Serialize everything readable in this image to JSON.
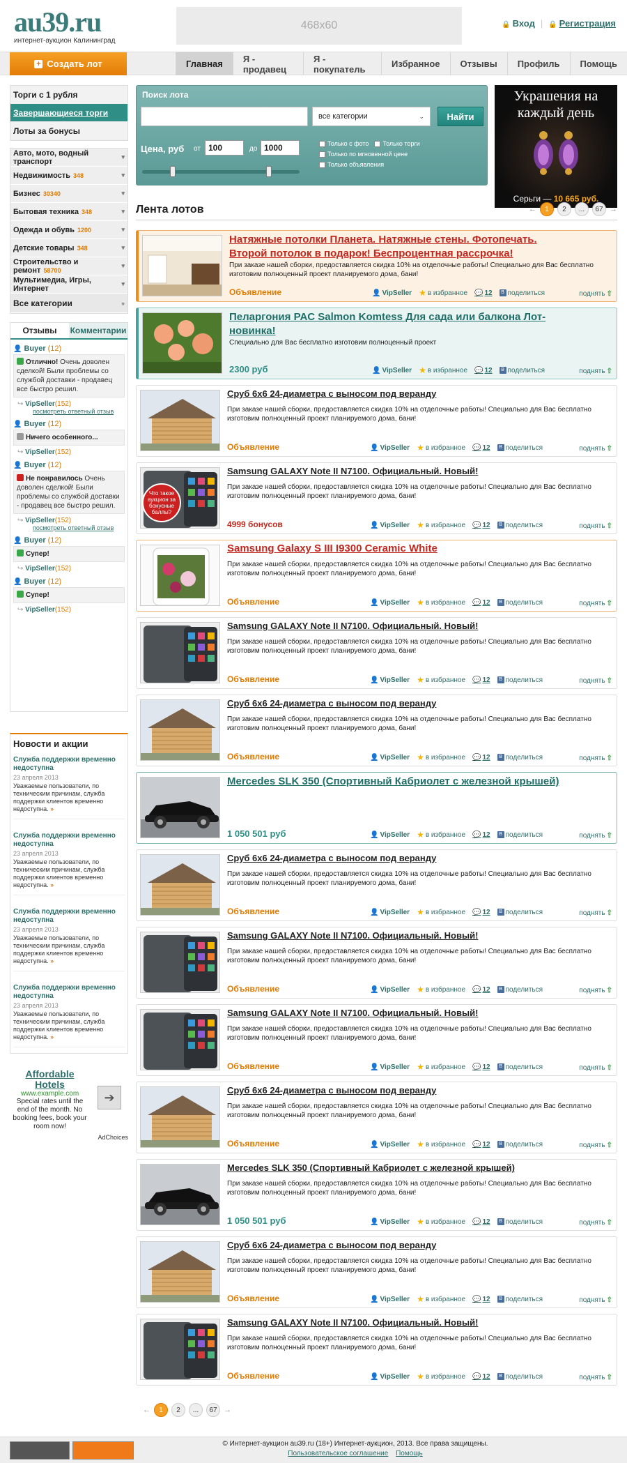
{
  "header": {
    "logo": "au39.ru",
    "logo_sub": "интернет-аукцион Калининград",
    "banner": "468x60",
    "login": "Вход",
    "register": "Регистрация"
  },
  "nav": {
    "create": "Создать лот",
    "tabs": [
      "Главная",
      "Я - продавец",
      "Я - покупатель",
      "Избранное",
      "Отзывы",
      "Профиль",
      "Помощь"
    ]
  },
  "left": {
    "links": [
      "Торги с 1 рубля",
      "Завершающиеся торги",
      "Лоты за бонусы"
    ],
    "categories": [
      {
        "name": "Авто, мото, водный транспорт",
        "count": ""
      },
      {
        "name": "Недвижимость",
        "count": "348"
      },
      {
        "name": "Бизнес",
        "count": "30340"
      },
      {
        "name": "Бытовая техника",
        "count": "348"
      },
      {
        "name": "Одежда и обувь",
        "count": "1200"
      },
      {
        "name": "Детские товары",
        "count": "348"
      },
      {
        "name": "Строительство и ремонт",
        "count": "58700"
      },
      {
        "name": "Мультимедиа, Игры, Интернет",
        "count": ""
      }
    ],
    "all_categories": "Все категории",
    "reviews_tab": "Отзывы",
    "comments_tab": "Комментарии",
    "reviews": [
      {
        "user": "Buyer",
        "n": "(12)",
        "title": "Отлично!",
        "text": " Очень доволен сделкой! Были проблемы со службой доставки - продавец все быстро решил.",
        "seller": "VipSeller",
        "sn": "(152)",
        "link": "посмотреть ответный отзыв",
        "color": "#3aa848"
      },
      {
        "user": "Buyer",
        "n": "(12)",
        "title": "Ничего особенного...",
        "text": "",
        "seller": "VipSeller",
        "sn": "(152)",
        "link": "",
        "color": "#999999"
      },
      {
        "user": "Buyer",
        "n": "(12)",
        "title": "Не понравилось",
        "text": " Очень доволен сделкой! Были проблемы со службой доставки - продавец все быстро решил.",
        "seller": "VipSeller",
        "sn": "(152)",
        "link": "посмотреть ответный отзыв",
        "color": "#cc1f1f"
      },
      {
        "user": "Buyer",
        "n": "(12)",
        "title": "Супер!",
        "text": "",
        "seller": "VipSeller",
        "sn": "(152)",
        "link": "",
        "color": "#3aa848"
      },
      {
        "user": "Buyer",
        "n": "(12)",
        "title": "Супер!",
        "text": "",
        "seller": "VipSeller",
        "sn": "(152)",
        "link": "",
        "color": "#3aa848"
      }
    ],
    "news_title": "Новости и акции",
    "news": [
      {
        "title": "Служба поддержки временно недоступна",
        "date": "23 апреля 2013",
        "text": "Уважаемые пользователи, по техническим причинам, служба поддержки клиентов временно недоступна."
      },
      {
        "title": "Служба поддержки временно недоступна",
        "date": "23 апреля 2013",
        "text": "Уважаемые пользователи, по техническим причинам, служба поддержки клиентов временно недоступна."
      },
      {
        "title": "Служба поддержки временно недоступна",
        "date": "23 апреля 2013",
        "text": "Уважаемые пользователи, по техническим причинам, служба поддержки клиентов временно недоступна."
      },
      {
        "title": "Служба поддержки временно недоступна",
        "date": "23 апреля 2013",
        "text": "Уважаемые пользователи, по техническим причинам, служба поддержки клиентов временно недоступна."
      }
    ],
    "ad": {
      "title": "Affordable Hotels",
      "url": "www.example.com",
      "text": "Special rates until the end of the month. No booking fees, book your room now!",
      "choices": "AdChoices"
    }
  },
  "search": {
    "label": "Поиск лота",
    "category": "все категории",
    "button": "Найти",
    "price_label": "Цена, руб",
    "from_label": "от",
    "from": "100",
    "to_label": "до",
    "to": "1000",
    "checks": [
      "Только с фото",
      "Только торги",
      "Только по мгновенной цене",
      "Только объявления"
    ],
    "price_range": {
      "min": 100,
      "max": 1000
    }
  },
  "promo": {
    "title": "Украшения на каждый день",
    "text": "Серьги — ",
    "price": "10 665 руб."
  },
  "feed": {
    "title": "Лента лотов",
    "pages": [
      "1",
      "2",
      "...",
      "67"
    ],
    "current": "1"
  },
  "actions": {
    "seller": "VipSeller",
    "fav": "в избранное",
    "comments": "12",
    "share": "поделиться",
    "up": "поднять"
  },
  "lots": [
    {
      "style": "orange",
      "img": "room",
      "title": "Натяжные потолки Планета. Натяжные стены. Фотопечать. Второй потолок в подарок! Беспроцентная рассрочка!",
      "desc": "При заказе нашей сборки, предоставляется скидка 10% на отделочные работы! Специально для Вас бесплатно изготовим полноценный проект планируемого дома, бани!",
      "price": "Объявление",
      "pricecls": ""
    },
    {
      "style": "teal",
      "img": "flower",
      "title": "Пеларгония PAC Salmon Komtess Для сада или балкона Лот-новинка!",
      "desc": "Специально для Вас бесплатно изготовим полноценный проект",
      "price": "2300 руб",
      "pricecls": "teal"
    },
    {
      "style": "",
      "img": "house",
      "title": "Сруб 6х6 24-диаметра с выносом под веранду",
      "desc": "При заказе нашей сборки, предоставляется скидка 10% на отделочные работы! Специально для Вас бесплатно изготовим полноценный проект планируемого дома, бани!",
      "price": "Объявление",
      "pricecls": ""
    },
    {
      "style": "",
      "img": "phone",
      "badge": "Что такое аукцион за бонусные баллы?",
      "title": "Samsung GALAXY Note II N7100. Официальный. Новый!",
      "desc": "При заказе нашей сборки, предоставляется скидка 10% на отделочные работы! Специально для Вас бесплатно изготовим полноценный проект планируемого дома, бани!",
      "price": "4999 бонусов",
      "pricecls": "red"
    },
    {
      "style": "orangeb",
      "img": "phonew",
      "title": "Samsung Galaxy S III I9300 Ceramic White",
      "desc": "При заказе нашей сборки, предоставляется скидка 10% на отделочные работы! Специально для Вас бесплатно изготовим полноценный проект планируемого дома, бани!",
      "price": "Объявление",
      "pricecls": ""
    },
    {
      "style": "",
      "img": "phone",
      "title": "Samsung GALAXY Note II N7100. Официальный. Новый!",
      "desc": "При заказе нашей сборки, предоставляется скидка 10% на отделочные работы! Специально для Вас бесплатно изготовим полноценный проект планируемого дома, бани!",
      "price": "Объявление",
      "pricecls": ""
    },
    {
      "style": "",
      "img": "house",
      "title": "Сруб 6х6 24-диаметра с выносом под веранду",
      "desc": "При заказе нашей сборки, предоставляется скидка 10% на отделочные работы! Специально для Вас бесплатно изготовим полноценный проект планируемого дома, бани!",
      "price": "Объявление",
      "pricecls": ""
    },
    {
      "style": "tealb",
      "img": "car",
      "title": "Mercedes SLK 350 (Спортивный Кабриолет с железной крышей)",
      "desc": "",
      "price": "1 050 501 руб",
      "pricecls": "teal"
    },
    {
      "style": "",
      "img": "house",
      "title": "Сруб 6х6 24-диаметра с выносом под веранду",
      "desc": "При заказе нашей сборки, предоставляется скидка 10% на отделочные работы! Специально для Вас бесплатно изготовим полноценный проект планируемого дома, бани!",
      "price": "Объявление",
      "pricecls": ""
    },
    {
      "style": "",
      "img": "phone",
      "title": "Samsung GALAXY Note II N7100. Официальный. Новый!",
      "desc": "При заказе нашей сборки, предоставляется скидка 10% на отделочные работы! Специально для Вас бесплатно изготовим полноценный проект планируемого дома, бани!",
      "price": "Объявление",
      "pricecls": ""
    },
    {
      "style": "",
      "img": "phone",
      "title": "Samsung GALAXY Note II N7100. Официальный. Новый!",
      "desc": "При заказе нашей сборки, предоставляется скидка 10% на отделочные работы! Специально для Вас бесплатно изготовим полноценный проект планируемого дома, бани!",
      "price": "Объявление",
      "pricecls": ""
    },
    {
      "style": "",
      "img": "house",
      "title": "Сруб 6х6 24-диаметра с выносом под веранду",
      "desc": "При заказе нашей сборки, предоставляется скидка 10% на отделочные работы! Специально для Вас бесплатно изготовим полноценный проект планируемого дома, бани!",
      "price": "Объявление",
      "pricecls": ""
    },
    {
      "style": "",
      "img": "car",
      "title": "Mercedes SLK 350 (Спортивный Кабриолет с железной крышей)",
      "desc": "При заказе нашей сборки, предоставляется скидка 10% на отделочные работы! Специально для Вас бесплатно изготовим полноценный проект планируемого дома, бани!",
      "price": "1 050 501 руб",
      "pricecls": "teal"
    },
    {
      "style": "",
      "img": "house",
      "title": "Сруб 6х6 24-диаметра с выносом под веранду",
      "desc": "При заказе нашей сборки, предоставляется скидка 10% на отделочные работы! Специально для Вас бесплатно изготовим полноценный проект планируемого дома, бани!",
      "price": "Объявление",
      "pricecls": ""
    },
    {
      "style": "",
      "img": "phone",
      "title": "Samsung GALAXY Note II N7100. Официальный. Новый!",
      "desc": "При заказе нашей сборки, предоставляется скидка 10% на отделочные работы! Специально для Вас бесплатно изготовим полноценный проект планируемого дома, бани!",
      "price": "Объявление",
      "pricecls": ""
    }
  ],
  "footer": {
    "copyright": "© Интернет-аукцион au39.ru (18+) Интернет-аукцион, 2013. Все права защищены.",
    "links": [
      "Пользовательское соглашение",
      "Помощь"
    ]
  }
}
